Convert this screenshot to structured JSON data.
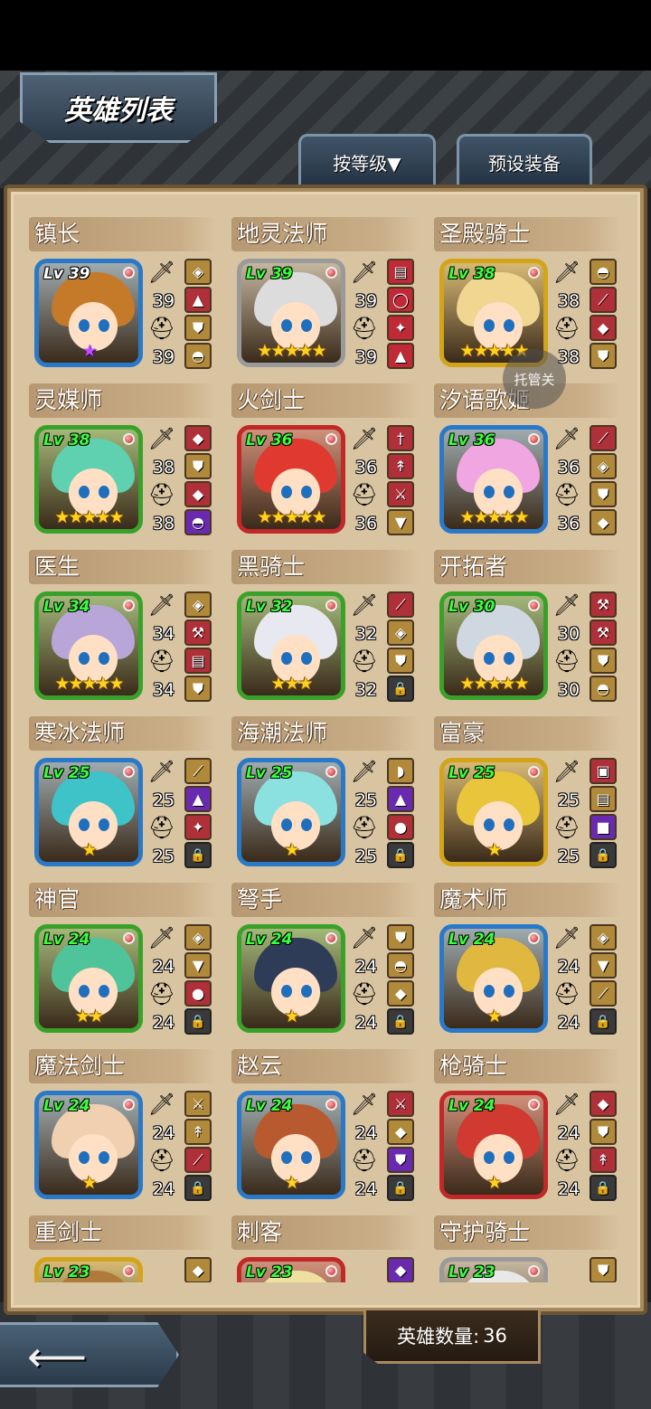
{
  "header": {
    "title": "英雄列表"
  },
  "tabs": {
    "sort_label": "按等级▼",
    "preset_label": "预设装备"
  },
  "float_button": {
    "label": "托管关"
  },
  "footer": {
    "hero_count_label": "英雄数量:",
    "hero_count_value": "36"
  },
  "icons": {
    "weapon": "sword-icon",
    "armor": "helmet-icon",
    "lock": "lock-icon",
    "back": "back-arrow-icon"
  },
  "heroes": [
    {
      "name": "镇长",
      "level": "Lv 39",
      "weapon": "39",
      "armor": "39",
      "stars": "★",
      "star_color": "purple",
      "frame": "#2a79c9",
      "hair": "#c57a2a",
      "slots": [
        "bag",
        "hat",
        "shield",
        "helmet"
      ],
      "slot_colors": [
        "#b08a3a",
        "#b0303a",
        "#b08a3a",
        "#b08a3a"
      ]
    },
    {
      "name": "地灵法师",
      "level": "Lv 39",
      "weapon": "39",
      "armor": "39",
      "stars": "★★★★★",
      "frame": "#9a9a9a",
      "hair": "#dcdcdc",
      "slots": [
        "book",
        "ring",
        "amulet",
        "hat"
      ],
      "slot_colors": [
        "#c02a36",
        "#c02a36",
        "#c02a36",
        "#c02a36"
      ]
    },
    {
      "name": "圣殿骑士",
      "level": "Lv 38",
      "weapon": "38",
      "armor": "38",
      "stars": "★★★★★",
      "frame": "#d2a41a",
      "hair": "#f0d690",
      "slots": [
        "helmet",
        "staff",
        "armor",
        "shield"
      ],
      "slot_colors": [
        "#b08a3a",
        "#b0303a",
        "#b0303a",
        "#b08a3a"
      ]
    },
    {
      "name": "灵媒师",
      "level": "Lv 38",
      "weapon": "38",
      "armor": "38",
      "stars": "★★★★★",
      "frame": "#39a12a",
      "hair": "#5fd0b0",
      "slots": [
        "gem",
        "shield",
        "armor",
        "helmet"
      ],
      "slot_colors": [
        "#b0303a",
        "#b08a3a",
        "#b0303a",
        "#6a2ab0"
      ]
    },
    {
      "name": "火剑士",
      "level": "Lv 36",
      "weapon": "36",
      "armor": "36",
      "stars": "★★★★★",
      "frame": "#c0282a",
      "hair": "#e03a30",
      "slots": [
        "dagger",
        "spear",
        "sword",
        "coat"
      ],
      "slot_colors": [
        "#b0303a",
        "#b0303a",
        "#b0303a",
        "#b08a3a"
      ]
    },
    {
      "name": "汐语歌姬",
      "level": "Lv 36",
      "weapon": "36",
      "armor": "36",
      "stars": "★★★★★",
      "frame": "#2a79c9",
      "hair": "#f0a6e0",
      "slots": [
        "wand",
        "bag",
        "shield",
        "armor"
      ],
      "slot_colors": [
        "#b0303a",
        "#b08a3a",
        "#b08a3a",
        "#b08a3a"
      ]
    },
    {
      "name": "医生",
      "level": "Lv 34",
      "weapon": "34",
      "armor": "34",
      "stars": "★★★★★",
      "frame": "#39a12a",
      "hair": "#b8a6d8",
      "slots": [
        "bag",
        "hammer",
        "book",
        "shield"
      ],
      "slot_colors": [
        "#b08a3a",
        "#b0303a",
        "#b0303a",
        "#b08a3a"
      ]
    },
    {
      "name": "黑骑士",
      "level": "Lv 32",
      "weapon": "32",
      "armor": "32",
      "stars": "★★★",
      "frame": "#39a12a",
      "hair": "#e8e8f0",
      "slots": [
        "blade",
        "bag",
        "shield",
        "lock"
      ],
      "slot_colors": [
        "#b0303a",
        "#b08a3a",
        "#b08a3a",
        "lock"
      ]
    },
    {
      "name": "开拓者",
      "level": "Lv 30",
      "weapon": "30",
      "armor": "30",
      "stars": "★★★★★",
      "frame": "#39a12a",
      "hair": "#cfd8e0",
      "slots": [
        "axe",
        "hammer",
        "shield",
        "helmet"
      ],
      "slot_colors": [
        "#b0303a",
        "#b0303a",
        "#b08a3a",
        "#b08a3a"
      ]
    },
    {
      "name": "寒冰法师",
      "level": "Lv 25",
      "weapon": "25",
      "armor": "25",
      "stars": "★",
      "frame": "#2a79c9",
      "hair": "#3ec4c8",
      "slots": [
        "staff",
        "hat",
        "amulet",
        "lock"
      ],
      "slot_colors": [
        "#b08a3a",
        "#6a2ab0",
        "#b0303a",
        "lock"
      ]
    },
    {
      "name": "海潮法师",
      "level": "Lv 25",
      "weapon": "25",
      "armor": "25",
      "stars": "★",
      "frame": "#2a79c9",
      "hair": "#8be0e0",
      "slots": [
        "shell",
        "hat",
        "orb",
        "lock"
      ],
      "slot_colors": [
        "#b08a3a",
        "#6a2ab0",
        "#b0303a",
        "lock"
      ]
    },
    {
      "name": "富豪",
      "level": "Lv 25",
      "weapon": "25",
      "armor": "25",
      "stars": "★",
      "frame": "#d2a41a",
      "hair": "#e8c53a",
      "slots": [
        "chest",
        "book",
        "box",
        "lock"
      ],
      "slot_colors": [
        "#b0303a",
        "#b08a3a",
        "#6a2ab0",
        "lock"
      ]
    },
    {
      "name": "神官",
      "level": "Lv 24",
      "weapon": "24",
      "armor": "24",
      "stars": "★★",
      "frame": "#39a12a",
      "hair": "#4fc49a",
      "slots": [
        "bag",
        "coat",
        "orb",
        "lock"
      ],
      "slot_colors": [
        "#b08a3a",
        "#b08a3a",
        "#b0303a",
        "lock"
      ]
    },
    {
      "name": "弩手",
      "level": "Lv 24",
      "weapon": "24",
      "armor": "24",
      "stars": "★",
      "frame": "#39a12a",
      "hair": "#2f3c58",
      "slots": [
        "shield",
        "helmet",
        "armor",
        "lock"
      ],
      "slot_colors": [
        "#b08a3a",
        "#b08a3a",
        "#b08a3a",
        "lock"
      ]
    },
    {
      "name": "魔术师",
      "level": "Lv 24",
      "weapon": "24",
      "armor": "24",
      "stars": "★",
      "frame": "#2a79c9",
      "hair": "#e0b840",
      "slots": [
        "bag",
        "coat",
        "wand",
        "lock"
      ],
      "slot_colors": [
        "#b08a3a",
        "#b08a3a",
        "#b08a3a",
        "lock"
      ]
    },
    {
      "name": "魔法剑士",
      "level": "Lv 24",
      "weapon": "24",
      "armor": "24",
      "stars": "★",
      "frame": "#2a79c9",
      "hair": "#f0d0b0",
      "slots": [
        "sword",
        "spear",
        "blade",
        "lock"
      ],
      "slot_colors": [
        "#b08a3a",
        "#b08a3a",
        "#b0303a",
        "lock"
      ]
    },
    {
      "name": "赵云",
      "level": "Lv 24",
      "weapon": "24",
      "armor": "24",
      "stars": "★",
      "frame": "#2a79c9",
      "hair": "#b85a30",
      "slots": [
        "sword",
        "armor",
        "shield",
        "lock"
      ],
      "slot_colors": [
        "#b0303a",
        "#b08a3a",
        "#6a2ab0",
        "lock"
      ]
    },
    {
      "name": "枪骑士",
      "level": "Lv 24",
      "weapon": "24",
      "armor": "24",
      "stars": "★",
      "frame": "#c0282a",
      "hair": "#d03a30",
      "slots": [
        "armor",
        "shield",
        "spear",
        "lock"
      ],
      "slot_colors": [
        "#b0303a",
        "#b08a3a",
        "#b0303a",
        "lock"
      ]
    },
    {
      "name": "重剑士",
      "level": "Lv 23",
      "weapon": "",
      "armor": "",
      "stars": "",
      "frame": "#d2a41a",
      "hair": "#b07a3a",
      "slots": [
        "armor"
      ],
      "slot_colors": [
        "#b08a3a"
      ]
    },
    {
      "name": "刺客",
      "level": "Lv 23",
      "weapon": "",
      "armor": "",
      "stars": "",
      "frame": "#c0282a",
      "hair": "#f0e0a0",
      "slots": [
        "armor"
      ],
      "slot_colors": [
        "#6a2ab0"
      ]
    },
    {
      "name": "守护骑士",
      "level": "Lv 23",
      "weapon": "",
      "armor": "",
      "stars": "",
      "frame": "#9a9a9a",
      "hair": "#e8e8e8",
      "slots": [
        "shield"
      ],
      "slot_colors": [
        "#b08a3a"
      ]
    }
  ]
}
